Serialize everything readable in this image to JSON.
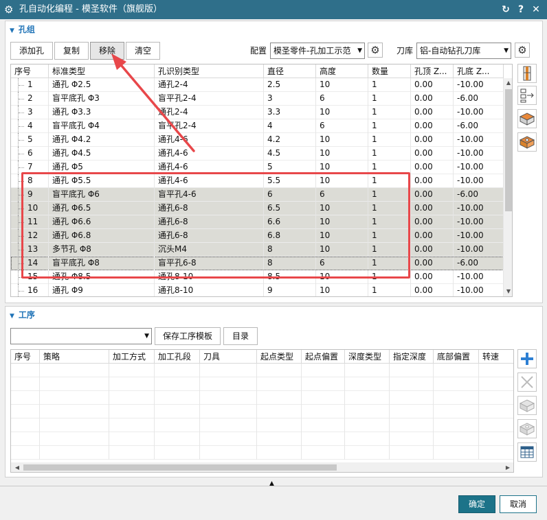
{
  "window": {
    "title": "孔自动化编程 - 模圣软件（旗舰版）",
    "icons": [
      "gear-icon",
      "reset-icon",
      "help-icon",
      "close-icon"
    ]
  },
  "hole_group": {
    "section_title": "孔组",
    "buttons": {
      "add": "添加孔",
      "copy": "复制",
      "remove": "移除",
      "clear": "清空"
    },
    "config_label": "配置",
    "config_value": "模圣零件-孔加工示范",
    "toollib_label": "刀库",
    "toollib_value": "铝-自动钻孔刀库",
    "columns": [
      "序号",
      "标准类型",
      "孔识别类型",
      "直径",
      "高度",
      "数量",
      "孔顶 Z...",
      "孔底 Z..."
    ],
    "rows": [
      [
        "1",
        "通孔 Φ2.5",
        "通孔2-4",
        "2.5",
        "10",
        "1",
        "0.00",
        "-10.00"
      ],
      [
        "2",
        "盲平底孔 Φ3",
        "盲平孔2-4",
        "3",
        "6",
        "1",
        "0.00",
        "-6.00"
      ],
      [
        "3",
        "通孔 Φ3.3",
        "通孔2-4",
        "3.3",
        "10",
        "1",
        "0.00",
        "-10.00"
      ],
      [
        "4",
        "盲平底孔 Φ4",
        "盲平孔2-4",
        "4",
        "6",
        "1",
        "0.00",
        "-6.00"
      ],
      [
        "5",
        "通孔 Φ4.2",
        "通孔4-6",
        "4.2",
        "10",
        "1",
        "0.00",
        "-10.00"
      ],
      [
        "6",
        "通孔 Φ4.5",
        "通孔4-6",
        "4.5",
        "10",
        "1",
        "0.00",
        "-10.00"
      ],
      [
        "7",
        "通孔 Φ5",
        "通孔4-6",
        "5",
        "10",
        "1",
        "0.00",
        "-10.00"
      ],
      [
        "8",
        "通孔 Φ5.5",
        "通孔4-6",
        "5.5",
        "10",
        "1",
        "0.00",
        "-10.00"
      ],
      [
        "9",
        "盲平底孔 Φ6",
        "盲平孔4-6",
        "6",
        "6",
        "1",
        "0.00",
        "-6.00"
      ],
      [
        "10",
        "通孔 Φ6.5",
        "通孔6-8",
        "6.5",
        "10",
        "1",
        "0.00",
        "-10.00"
      ],
      [
        "11",
        "通孔 Φ6.6",
        "通孔6-8",
        "6.6",
        "10",
        "1",
        "0.00",
        "-10.00"
      ],
      [
        "12",
        "通孔 Φ6.8",
        "通孔6-8",
        "6.8",
        "10",
        "1",
        "0.00",
        "-10.00"
      ],
      [
        "13",
        "多节孔 Φ8",
        "沉头M4",
        "8",
        "10",
        "1",
        "0.00",
        "-10.00"
      ],
      [
        "14",
        "盲平底孔 Φ8",
        "盲平孔6-8",
        "8",
        "6",
        "1",
        "0.00",
        "-6.00"
      ],
      [
        "15",
        "通孔 Φ8.5",
        "通孔8-10",
        "8.5",
        "10",
        "1",
        "0.00",
        "-10.00"
      ],
      [
        "16",
        "通孔 Φ9",
        "通孔8-10",
        "9",
        "10",
        "1",
        "0.00",
        "-10.00"
      ]
    ],
    "selected_rows": [
      "9",
      "10",
      "11",
      "12",
      "13",
      "14"
    ],
    "focused_row": "14",
    "side_icons": [
      "hole-feature-icon",
      "list-export-icon",
      "face-select-icon",
      "body-select-icon"
    ]
  },
  "operation": {
    "section_title": "工序",
    "template_value": "",
    "save_template": "保存工序模板",
    "catalog": "目录",
    "columns": [
      "序号",
      "策略",
      "加工方式",
      "加工孔段",
      "刀具",
      "起点类型",
      "起点偏置",
      "深度类型",
      "指定深度",
      "底部偏置",
      "转速"
    ],
    "side_icons": [
      "add-icon",
      "delete-icon",
      "face-op-icon",
      "body-op-icon",
      "table-icon"
    ]
  },
  "footer": {
    "ok": "确定",
    "cancel": "取消"
  },
  "colors": {
    "titlebar": "#2f6f8a",
    "accent": "#1f73b7",
    "highlight": "#e8474a",
    "ok_button": "#1c7389"
  }
}
